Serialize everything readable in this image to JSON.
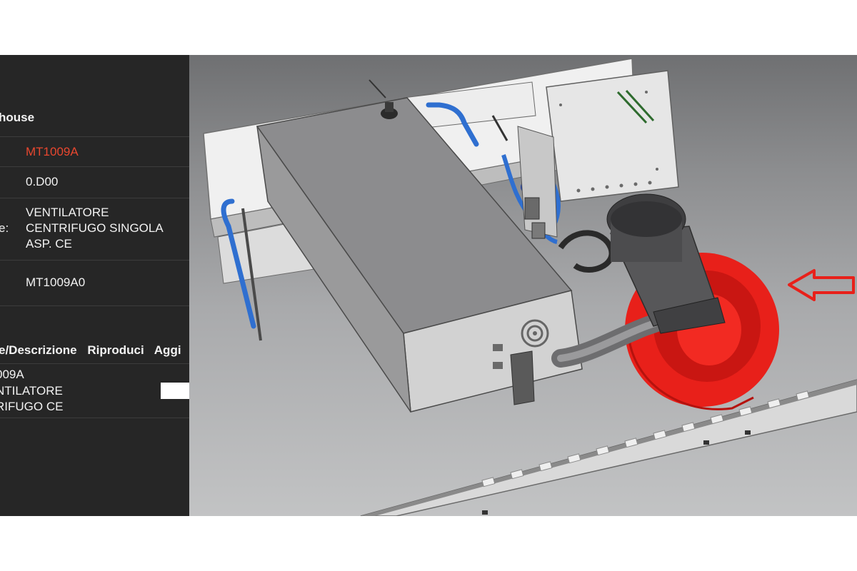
{
  "panel": {
    "header": "house",
    "fields": [
      {
        "label": "",
        "value": "MT1009A",
        "highlight": true
      },
      {
        "label": "",
        "value": "0.D00"
      },
      {
        "label": "e:",
        "value_lines": [
          "VENTILATORE",
          "CENTRIFUGO SINGOLA",
          "ASP. CE"
        ]
      },
      {
        "label": "",
        "value": "MT1009A0"
      }
    ],
    "table": {
      "headers": [
        "e/Descrizione",
        "Riproduci",
        "Aggi"
      ],
      "rows": [
        {
          "code": "009A",
          "desc_lines": [
            "NTILATORE",
            "RIFUGO CE"
          ],
          "qty": ""
        }
      ]
    }
  },
  "viewport": {
    "highlight_color": "#e8201a",
    "arrow_color": "#e8201a",
    "pipe_color": "#2f6fd0",
    "arrow_icon": "left-arrow-outline-icon"
  }
}
